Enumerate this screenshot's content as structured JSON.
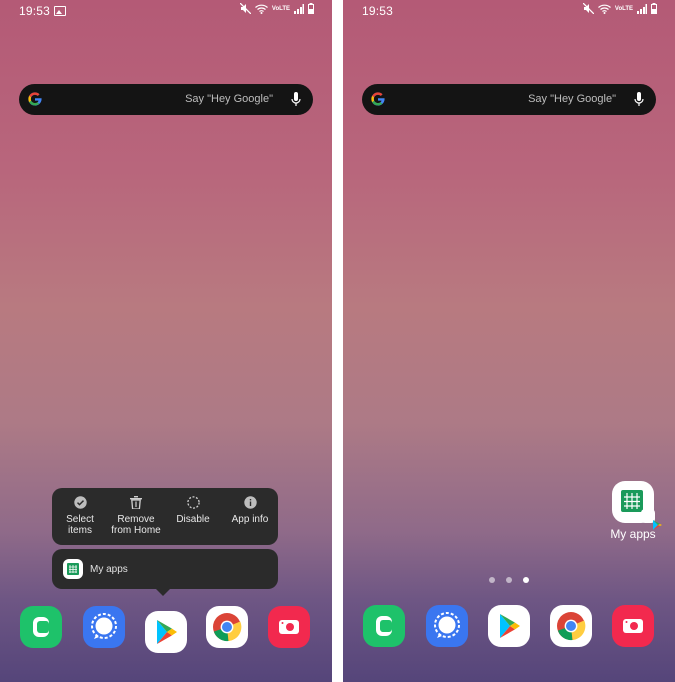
{
  "screens": [
    {
      "status_time": "19:53",
      "carrier": "VoLTE",
      "search_hint": "Say \"Hey Google\"",
      "menu_actions": [
        {
          "icon": "check-circle-icon",
          "label": "Select\nitems"
        },
        {
          "icon": "trash-icon",
          "label": "Remove\nfrom Home"
        },
        {
          "icon": "disable-icon",
          "label": "Disable"
        },
        {
          "icon": "info-icon",
          "label": "App info"
        }
      ],
      "shortcut_label": "My apps"
    },
    {
      "status_time": "19:53",
      "carrier": "VoLTE",
      "search_hint": "Say \"Hey Google\"",
      "widget_label": "My apps",
      "page_count": 3,
      "active_page": 3
    }
  ],
  "dock": [
    "phone-app-icon",
    "signal-app-icon",
    "play-store-icon",
    "chrome-icon",
    "camera-app-icon"
  ],
  "colors": {
    "phone": "#1ec26a",
    "signal": "#3a76f0",
    "camera": "#f2294e",
    "menu_bg": "#2b2b2b",
    "search_bg": "#141414"
  }
}
